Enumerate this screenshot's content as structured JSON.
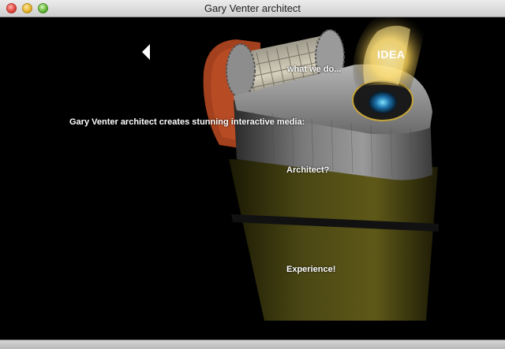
{
  "window": {
    "title": "Gary Venter architect"
  },
  "nav": {
    "back_icon": "left-triangle-icon",
    "idea_label": "IDEA",
    "what_label": "what we do...",
    "architect_label": "Architect?",
    "experience_label": "Experience!"
  },
  "intro": {
    "text": "Gary Venter architect creates stunning interactive media:"
  },
  "colors": {
    "background": "#000000",
    "text": "#ffffff",
    "flame": "#f4c24a",
    "lighter_body": "#5a5418",
    "cap": "#8a8a8a",
    "red_guard": "#b2421f"
  }
}
